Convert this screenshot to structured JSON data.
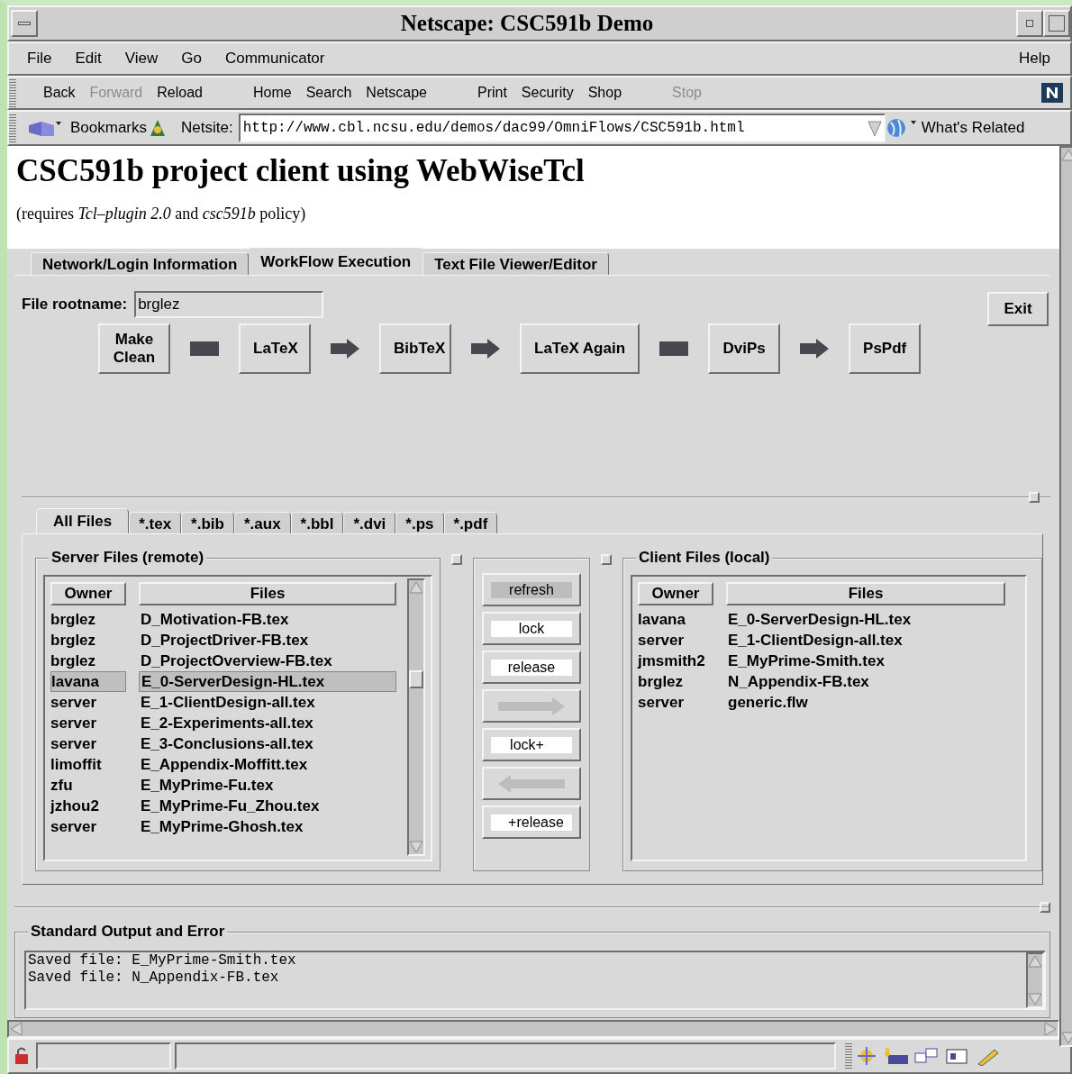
{
  "window": {
    "title": "Netscape: CSC591b Demo"
  },
  "menu": {
    "items": [
      "File",
      "Edit",
      "View",
      "Go",
      "Communicator"
    ],
    "help": "Help"
  },
  "toolbar": {
    "groups": [
      {
        "buttons": [
          {
            "label": "Back",
            "disabled": false
          },
          {
            "label": "Forward",
            "disabled": true
          },
          {
            "label": "Reload",
            "disabled": false
          }
        ]
      },
      {
        "buttons": [
          {
            "label": "Home",
            "disabled": false
          },
          {
            "label": "Search",
            "disabled": false
          },
          {
            "label": "Netscape",
            "disabled": false
          }
        ]
      },
      {
        "buttons": [
          {
            "label": "Print",
            "disabled": false
          },
          {
            "label": "Security",
            "disabled": false
          },
          {
            "label": "Shop",
            "disabled": false
          }
        ]
      },
      {
        "buttons": [
          {
            "label": "Stop",
            "disabled": true
          }
        ]
      }
    ]
  },
  "location": {
    "bookmarks": "Bookmarks",
    "label": "Netsite:",
    "url": "http://www.cbl.ncsu.edu/demos/dac99/OmniFlows/CSC591b.html",
    "related": "What's Related"
  },
  "page": {
    "heading": "CSC591b project client using WebWiseTcl",
    "subtitle": "(requires *Tcl–plugin 2.0* and *csc591b* policy)"
  },
  "tabs": [
    {
      "label": "Network/Login Information",
      "selected": false
    },
    {
      "label": "WorkFlow Execution",
      "selected": true
    },
    {
      "label": "Text File Viewer/Editor",
      "selected": false
    }
  ],
  "rootname": {
    "label": "File rootname:",
    "value": "brglez"
  },
  "exit": "Exit",
  "workflow": [
    {
      "kind": "step",
      "label": "Make Clean"
    },
    {
      "kind": "bar"
    },
    {
      "kind": "step",
      "label": "LaTeX"
    },
    {
      "kind": "arrow"
    },
    {
      "kind": "step",
      "label": "BibTeX"
    },
    {
      "kind": "arrow"
    },
    {
      "kind": "step",
      "label": "LaTeX Again"
    },
    {
      "kind": "bar"
    },
    {
      "kind": "step",
      "label": "DviPs"
    },
    {
      "kind": "arrow"
    },
    {
      "kind": "step",
      "label": "PsPdf"
    }
  ],
  "filter_tabs": [
    {
      "label": "All Files",
      "selected": true
    },
    {
      "label": "*.tex",
      "selected": false
    },
    {
      "label": "*.bib",
      "selected": false
    },
    {
      "label": "*.aux",
      "selected": false
    },
    {
      "label": "*.bbl",
      "selected": false
    },
    {
      "label": "*.dvi",
      "selected": false
    },
    {
      "label": "*.ps",
      "selected": false
    },
    {
      "label": "*.pdf",
      "selected": false
    }
  ],
  "server": {
    "title": "Server Files (remote)",
    "columns": [
      "Owner",
      "Files"
    ],
    "rows": [
      {
        "owner": "brglez",
        "file": "D_Motivation-FB.tex",
        "selected": false
      },
      {
        "owner": "brglez",
        "file": "D_ProjectDriver-FB.tex",
        "selected": false
      },
      {
        "owner": "brglez",
        "file": "D_ProjectOverview-FB.tex",
        "selected": false
      },
      {
        "owner": "lavana",
        "file": "E_0-ServerDesign-HL.tex",
        "selected": true
      },
      {
        "owner": "server",
        "file": "E_1-ClientDesign-all.tex",
        "selected": false
      },
      {
        "owner": "server",
        "file": "E_2-Experiments-all.tex",
        "selected": false
      },
      {
        "owner": "server",
        "file": "E_3-Conclusions-all.tex",
        "selected": false
      },
      {
        "owner": "limoffit",
        "file": "E_Appendix-Moffitt.tex",
        "selected": false
      },
      {
        "owner": "zfu",
        "file": "E_MyPrime-Fu.tex",
        "selected": false
      },
      {
        "owner": "jzhou2",
        "file": "E_MyPrime-Fu_Zhou.tex",
        "selected": false
      },
      {
        "owner": "server",
        "file": "E_MyPrime-Ghosh.tex",
        "selected": false
      }
    ]
  },
  "actions": [
    {
      "kind": "text",
      "label": "refresh",
      "enabled": false
    },
    {
      "kind": "text",
      "label": "lock",
      "enabled": true
    },
    {
      "kind": "text",
      "label": "release",
      "enabled": true
    },
    {
      "kind": "arrow-right",
      "enabled": false
    },
    {
      "kind": "text-right",
      "label": "lock+",
      "enabled": true
    },
    {
      "kind": "arrow-left",
      "enabled": false
    },
    {
      "kind": "text-left",
      "label": "+release",
      "enabled": true
    }
  ],
  "client": {
    "title": "Client Files (local)",
    "columns": [
      "Owner",
      "Files"
    ],
    "rows": [
      {
        "owner": "lavana",
        "file": "E_0-ServerDesign-HL.tex",
        "selected": false
      },
      {
        "owner": "server",
        "file": "E_1-ClientDesign-all.tex",
        "selected": false
      },
      {
        "owner": "jmsmith2",
        "file": "E_MyPrime-Smith.tex",
        "selected": false
      },
      {
        "owner": "brglez",
        "file": "N_Appendix-FB.tex",
        "selected": false
      },
      {
        "owner": "server",
        "file": "generic.flw",
        "selected": false
      }
    ]
  },
  "output": {
    "title": "Standard Output and Error",
    "lines": [
      "Saved file: E_MyPrime-Smith.tex",
      "Saved file: N_Appendix-FB.tex"
    ]
  }
}
